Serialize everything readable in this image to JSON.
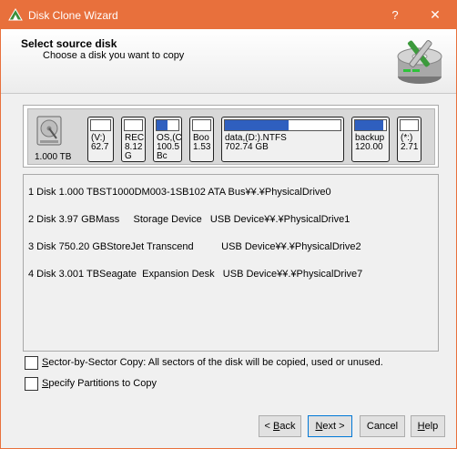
{
  "window": {
    "title": "Disk Clone Wizard",
    "help_label": "?",
    "close_label": "✕",
    "accent": "#e8703c"
  },
  "header": {
    "title": "Select source disk",
    "subtitle": "Choose a disk you want to copy"
  },
  "disk_map": {
    "disk_size": "1.000 TB",
    "partitions": [
      {
        "lines": [
          "(V:)",
          "62.7"
        ],
        "used": 0
      },
      {
        "lines": [
          "REC",
          "8.12",
          "G"
        ],
        "used": 0
      },
      {
        "lines": [
          "OS,(C",
          "100.5",
          "Bc"
        ],
        "used": 0.5
      },
      {
        "lines": [
          "Boo",
          "1.53"
        ],
        "used": 0
      },
      {
        "lines": [
          "data,(D:).NTFS",
          "702.74 GB"
        ],
        "used": 0.55
      },
      {
        "lines": [
          "backup",
          "120.00"
        ],
        "used": 0.9
      },
      {
        "lines": [
          "(*:)",
          "2.71"
        ],
        "used": 0
      }
    ]
  },
  "disk_list": [
    "1 Disk 1.000 TBST1000DM003-1SB102 ATA Bus¥¥.¥PhysicalDrive0",
    "2 Disk 3.97 GBMass     Storage Device   USB Device¥¥.¥PhysicalDrive1",
    "3 Disk 750.20 GBStoreJet Transcend          USB Device¥¥.¥PhysicalDrive2",
    "4 Disk 3.001 TBSeagate  Expansion Desk   USB Device¥¥.¥PhysicalDrive7"
  ],
  "options": {
    "sector_copy": {
      "pre": "",
      "mnemonic": "S",
      "post": "ector-by-Sector Copy: All sectors of the disk will be copied, used or unused.",
      "checked": false
    },
    "specify_partitions": {
      "pre": "",
      "mnemonic": "S",
      "post": "pecify Partitions to Copy",
      "checked": false
    }
  },
  "buttons": {
    "back": {
      "pre": "< ",
      "mnemonic": "B",
      "post": "ack"
    },
    "next": {
      "pre": "",
      "mnemonic": "N",
      "post": "ext >"
    },
    "cancel": {
      "pre": "Cancel",
      "mnemonic": "",
      "post": ""
    },
    "help": {
      "pre": "",
      "mnemonic": "H",
      "post": "elp"
    }
  }
}
